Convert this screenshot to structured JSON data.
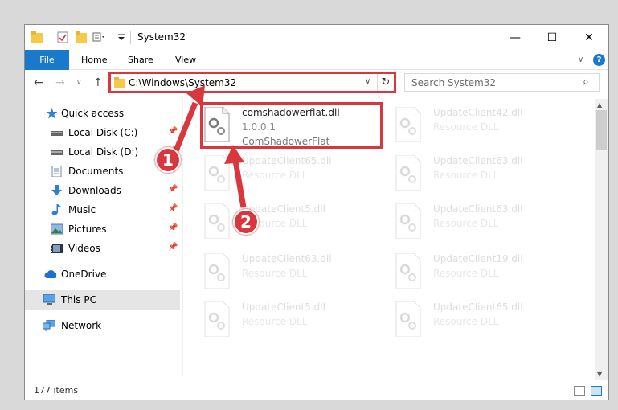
{
  "window": {
    "title": "System32",
    "minimize_glyph": "—",
    "maximize_glyph": "☐",
    "close_glyph": "✕"
  },
  "ribbon": {
    "tabs": [
      "File",
      "Home",
      "Share",
      "View"
    ],
    "expand_glyph": "∨",
    "help_glyph": "?"
  },
  "navigation": {
    "back_glyph": "←",
    "forward_glyph": "→",
    "recent_glyph": "∨",
    "up_glyph": "↑",
    "address": "C:\\Windows\\System32",
    "dropdown_glyph": "∨",
    "refresh_glyph": "↻",
    "search_placeholder": "Search System32",
    "search_glyph": "⌕"
  },
  "sidebar": {
    "items": [
      {
        "label": "Quick access",
        "icon": "star-icon",
        "pinned": false
      },
      {
        "label": "Local Disk (C:)",
        "icon": "drive-icon",
        "pinned": true
      },
      {
        "label": "Local Disk (D:)",
        "icon": "drive-icon",
        "pinned": true
      },
      {
        "label": "Documents",
        "icon": "documents-icon",
        "pinned": true
      },
      {
        "label": "Downloads",
        "icon": "download-icon",
        "pinned": true
      },
      {
        "label": "Music",
        "icon": "music-icon",
        "pinned": true
      },
      {
        "label": "Pictures",
        "icon": "pictures-icon",
        "pinned": true
      },
      {
        "label": "Videos",
        "icon": "videos-icon",
        "pinned": true
      },
      {
        "label": "OneDrive",
        "icon": "cloud-icon",
        "pinned": false
      },
      {
        "label": "This PC",
        "icon": "computer-icon",
        "pinned": false,
        "selected": true
      },
      {
        "label": "Network",
        "icon": "network-icon",
        "pinned": false
      }
    ]
  },
  "files": {
    "highlighted": {
      "name": "comshadowerflat.dll",
      "version": "1.0.0.1",
      "description": "ComShadowerFlat"
    },
    "faded": [
      {
        "name": "UpdateClient65.dll",
        "type": "Resource DLL"
      },
      {
        "name": "UpdateClient5.dll",
        "type": "Resource DLL"
      },
      {
        "name": "UpdateClient63.dll",
        "type": "Resource DLL"
      },
      {
        "name": "UpdateClient5.dll",
        "type": "Resource DLL"
      },
      {
        "name": "UpdateClient42.dll",
        "type": "Resource DLL"
      },
      {
        "name": "UpdateClient63.dll",
        "type": "Resource DLL"
      },
      {
        "name": "UpdateClient63.dll",
        "type": "Resource DLL"
      },
      {
        "name": "UpdateClient19.dll",
        "type": "Resource DLL"
      },
      {
        "name": "UpdateClient65.dll",
        "type": "Resource DLL"
      }
    ]
  },
  "status": {
    "item_count": "177 items"
  },
  "callouts": [
    {
      "number": "1"
    },
    {
      "number": "2"
    }
  ],
  "colors": {
    "accent": "#1979ca",
    "highlight_red": "#d9363e",
    "selection": "#e5e5e5"
  }
}
